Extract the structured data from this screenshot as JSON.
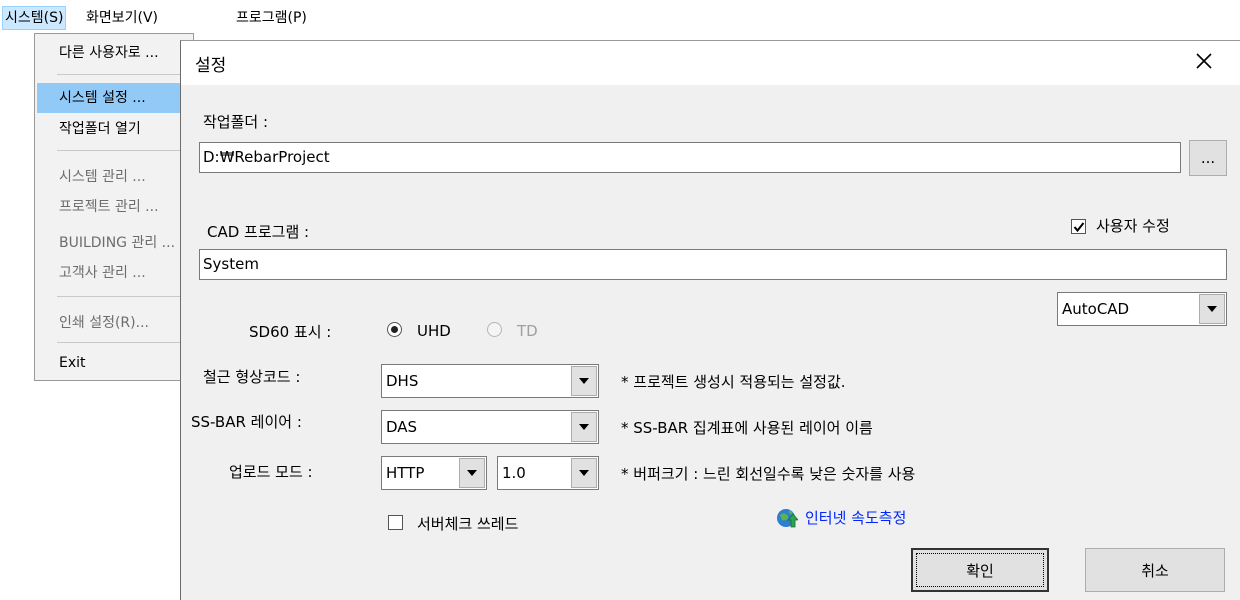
{
  "menubar": {
    "items": [
      {
        "label": "시스템(S)"
      },
      {
        "label": "화면보기(V)"
      },
      {
        "label": "프로그램(P)"
      }
    ]
  },
  "dropdown": {
    "items": [
      {
        "label": "다른 사용자로 ..."
      },
      {
        "label": "시스템 설정 ..."
      },
      {
        "label": "작업폴더 열기"
      },
      {
        "label": "시스템 관리 ..."
      },
      {
        "label": "프로젝트 관리 ..."
      },
      {
        "label": "BUILDING 관리 ..."
      },
      {
        "label": "고객사 관리 ..."
      },
      {
        "label": "인쇄 설정(R)..."
      },
      {
        "label": "Exit"
      }
    ]
  },
  "dialog": {
    "title": "설정",
    "close_icon": "close-icon",
    "work_folder": {
      "label": "작업폴더 :",
      "value": "D:₩RebarProject",
      "browse_label": "..."
    },
    "cad": {
      "label": "CAD 프로그램 :",
      "value": "System",
      "user_edit_label": "사용자 수정",
      "user_edit_checked": true,
      "program_selected": "AutoCAD"
    },
    "sd60": {
      "label": "SD60 표시 :",
      "options": [
        {
          "label": "UHD",
          "checked": true,
          "enabled": true
        },
        {
          "label": "TD",
          "checked": false,
          "enabled": false
        }
      ]
    },
    "rebar_code": {
      "label": "철근 형상코드 :",
      "selected": "DHS",
      "note": "* 프로젝트 생성시 적용되는 설정값."
    },
    "ssbar_layer": {
      "label": "SS-BAR 레이어 :",
      "selected": "DAS",
      "note": "* SS-BAR 집계표에 사용된 레이어 이름"
    },
    "upload": {
      "label": "업로드 모드 :",
      "mode_selected": "HTTP",
      "buffer_selected": "1.0",
      "note": "* 버퍼크기 : 느린 회선일수록 낮은 숫자를 사용",
      "speed_link": "인터넷 속도측정",
      "speed_icon": "globe-upload-icon"
    },
    "server_check": {
      "label": "서버체크 쓰레드",
      "checked": false
    },
    "buttons": {
      "ok": "확인",
      "cancel": "취소"
    }
  },
  "colors": {
    "menu_highlight": "#91c9f7",
    "menubar_active": "#cce8ff",
    "dialog_bg": "#f0f0f0",
    "link": "#0026ff"
  }
}
